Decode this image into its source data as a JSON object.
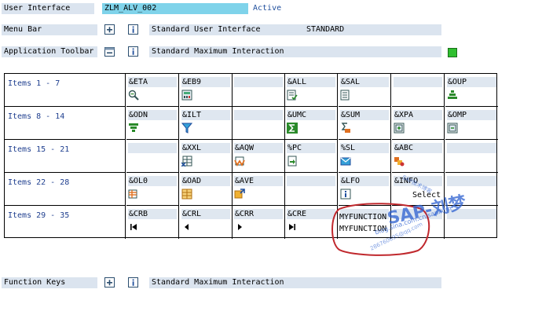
{
  "header": {
    "ui_label": "User Interface",
    "ui_value": "ZLM_ALV_002",
    "ui_status": "Active"
  },
  "menu_bar": {
    "label": "Menu Bar",
    "value": "Standard User Interface",
    "extra": "STANDARD",
    "icon_left": "expand-icon",
    "icon_right": "info-icon"
  },
  "app_toolbar": {
    "label": "Application Toolbar",
    "value": "Standard Maximum Interaction",
    "icon_left": "collapse-icon",
    "icon_right": "info-icon",
    "status_icon": "green-square-icon"
  },
  "function_keys": {
    "label": "Function Keys",
    "value": "Standard Maximum Interaction",
    "icon_left": "expand-icon",
    "icon_right": "info-icon"
  },
  "rows": [
    {
      "label": "Items  1 - 7",
      "cells": [
        {
          "code": "&ETA",
          "icon": "zoom-icon"
        },
        {
          "code": "&EB9",
          "icon": "calculator-icon"
        },
        {
          "code": "",
          "icon": ""
        },
        {
          "code": "&ALL",
          "icon": "select-all-icon"
        },
        {
          "code": "&SAL",
          "icon": "deselect-all-icon"
        },
        {
          "code": "",
          "icon": ""
        },
        {
          "code": "&OUP",
          "icon": "sort-ascending-icon"
        }
      ]
    },
    {
      "label": "Items  8 - 14",
      "cells": [
        {
          "code": "&ODN",
          "icon": "sort-descending-icon"
        },
        {
          "code": "&ILT",
          "icon": "filter-icon"
        },
        {
          "code": "",
          "icon": ""
        },
        {
          "code": "&UMC",
          "icon": "total-icon"
        },
        {
          "code": "&SUM",
          "icon": "subtotal-icon"
        },
        {
          "code": "&XPA",
          "icon": "expand-all-icon"
        },
        {
          "code": "&OMP",
          "icon": "collapse-all-icon"
        }
      ]
    },
    {
      "label": "Items 15 - 21",
      "cells": [
        {
          "code": "",
          "icon": ""
        },
        {
          "code": "&XXL",
          "icon": "spreadsheet-icon"
        },
        {
          "code": "&AQW",
          "icon": "word-processing-icon"
        },
        {
          "code": "%PC",
          "icon": "local-file-icon"
        },
        {
          "code": "%SL",
          "icon": "mail-recipient-icon"
        },
        {
          "code": "&ABC",
          "icon": "abc-analysis-icon"
        },
        {
          "code": "",
          "icon": ""
        }
      ]
    },
    {
      "label": "Items 22 - 28",
      "cells": [
        {
          "code": "&OL0",
          "icon": "change-layout-icon"
        },
        {
          "code": "&OAD",
          "icon": "select-layout-icon"
        },
        {
          "code": "&AVE",
          "icon": "save-layout-icon"
        },
        {
          "code": "",
          "icon": ""
        },
        {
          "code": "&LFO",
          "icon": "information-icon"
        },
        {
          "code": "&INFO",
          "icon": ""
        },
        {
          "code": "",
          "icon": ""
        }
      ]
    },
    {
      "label": "Items 29 - 35",
      "cells": [
        {
          "code": "&CRB",
          "icon": "first-column-icon"
        },
        {
          "code": "&CRL",
          "icon": "previous-column-icon"
        },
        {
          "code": "&CRR",
          "icon": "next-column-icon"
        },
        {
          "code": "&CRE",
          "icon": "last-column-icon"
        },
        {
          "code": "",
          "icon": ""
        },
        {
          "code": "",
          "icon": ""
        },
        {
          "code": "",
          "icon": ""
        }
      ]
    }
  ],
  "custom_functions": [
    "MYFUNCTION",
    "MYFUNCTION"
  ],
  "select_text": "Select",
  "watermark": {
    "brand": "SAP-刘梦",
    "url": "blog.sina.com.cn/saplium",
    "email": "286760695@qq.com",
    "side": "SAP技术博客"
  },
  "colors": {
    "field_bg": "#dbe4ef",
    "title_bg": "#7fd3ea",
    "status_text": "#1f4e9c",
    "highlight_ellipse": "#c0282d",
    "ok_green": "#2fbf2f"
  }
}
